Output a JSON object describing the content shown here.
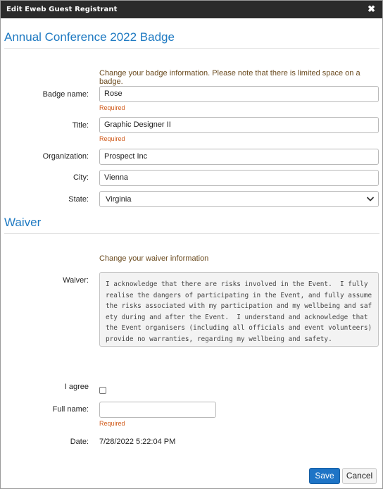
{
  "window": {
    "title": "Edit Eweb Guest Registrant",
    "close_glyph": "✖"
  },
  "badge_section": {
    "title": "Annual Conference 2022 Badge",
    "hint": "Change your badge information. Please note that there is limited space on a badge.",
    "fields": {
      "badge_name": {
        "label": "Badge name:",
        "value": "Rose",
        "required": "Required"
      },
      "title": {
        "label": "Title:",
        "value": "Graphic Designer II",
        "required": "Required"
      },
      "organization": {
        "label": "Organization:",
        "value": "Prospect Inc"
      },
      "city": {
        "label": "City:",
        "value": "Vienna"
      },
      "state": {
        "label": "State:",
        "value": "Virginia"
      }
    }
  },
  "waiver_section": {
    "title": "Waiver",
    "hint": "Change your waiver information",
    "waiver_label": "Waiver:",
    "waiver_text": "I acknowledge that there are risks involved in the Event.  I fully realise the dangers of participating in the Event, and fully assume the risks associated with my participation and my wellbeing and safety during and after the Event.  I understand and acknowledge that the Event organisers (including all officials and event volunteers) provide no warranties, regarding my wellbeing and safety.",
    "agree_label": "I agree",
    "agree_checked": false,
    "full_name_label": "Full name:",
    "full_name_value": "",
    "full_name_required": "Required",
    "date_label": "Date:",
    "date_value": "7/28/2022 5:22:04 PM"
  },
  "actions": {
    "save_label": "Save",
    "cancel_label": "Cancel"
  },
  "colors": {
    "accent": "#1f7ac2",
    "required": "#d05a1a",
    "titlebar": "#2b2b2b",
    "save_button": "#1e74c6"
  }
}
